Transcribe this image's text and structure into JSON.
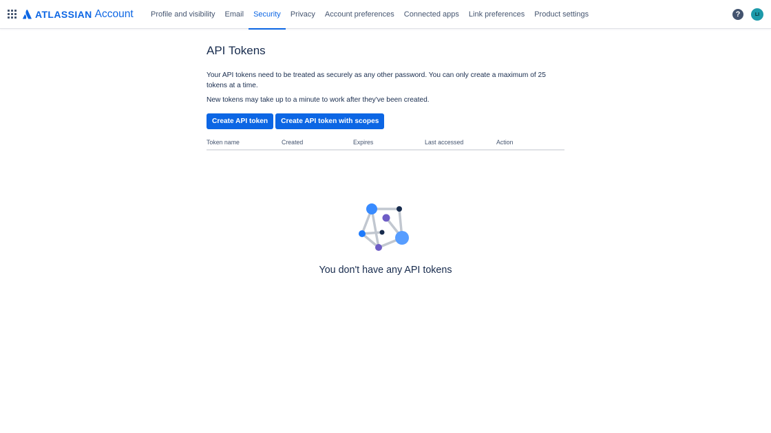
{
  "brand": {
    "name": "ATLASSIAN",
    "product": "Account",
    "color": "#0c66e4"
  },
  "nav": {
    "items": [
      {
        "label": "Profile and visibility",
        "active": false
      },
      {
        "label": "Email",
        "active": false
      },
      {
        "label": "Security",
        "active": true
      },
      {
        "label": "Privacy",
        "active": false
      },
      {
        "label": "Account preferences",
        "active": false
      },
      {
        "label": "Connected apps",
        "active": false
      },
      {
        "label": "Link preferences",
        "active": false
      },
      {
        "label": "Product settings",
        "active": false
      }
    ]
  },
  "header_icons": {
    "help": "help-icon",
    "avatar_initials": "LI",
    "avatar_color": "#1d9aaa"
  },
  "page": {
    "title": "API Tokens",
    "description_1": "Your API tokens need to be treated as securely as any other password. You can only create a maximum of 25 tokens at a time.",
    "description_2": "New tokens may take up to a minute to work after they've been created."
  },
  "buttons": {
    "create": "Create API token",
    "create_scoped": "Create API token with scopes"
  },
  "table": {
    "columns": [
      "Token name",
      "Created",
      "Expires",
      "Last accessed",
      "Action"
    ],
    "rows": []
  },
  "empty_state": {
    "title": "You don't have any API tokens",
    "illustration": "network-graph-illustration"
  }
}
